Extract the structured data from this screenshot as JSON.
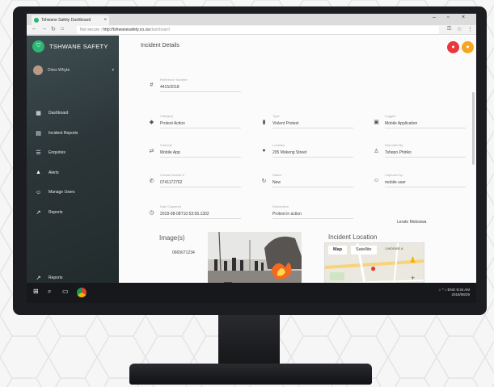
{
  "browser": {
    "tab_title": "Tshwane Safety Dashboard",
    "url_secure": "Not secure",
    "url_host": "http://tshwanesafety.co.za",
    "url_path": "/dashboard"
  },
  "sidebar": {
    "brand": "TSHWANE SAFETY",
    "user_name": "Dries Whyte",
    "items": [
      {
        "label": "Dashboard",
        "icon": "dashboard-icon"
      },
      {
        "label": "Incident Reports",
        "icon": "reports-icon"
      },
      {
        "label": "Enquiries",
        "icon": "enquiries-icon"
      },
      {
        "label": "Alerts",
        "icon": "bell-icon"
      },
      {
        "label": "Manage Users",
        "icon": "users-icon"
      },
      {
        "label": "Reports",
        "icon": "trend-icon"
      }
    ],
    "bottom_item": "Reports"
  },
  "incident": {
    "title": "Incident Details",
    "reference": {
      "label": "Reference Number",
      "value": "4415/2018"
    },
    "category": {
      "label": "Category",
      "value": "Protest Action"
    },
    "type": {
      "label": "Type",
      "value": "Violent Protest"
    },
    "logged": {
      "label": "Logged",
      "value": "Mobile Application"
    },
    "channel": {
      "label": "Channel",
      "value": "Mobile App"
    },
    "location": {
      "label": "Location",
      "value": "205 Mokeng Street"
    },
    "reported_by": {
      "label": "Reported By",
      "value": "Tshepo Phiriko"
    },
    "contact": {
      "label": "Contact Mobile #",
      "value": "0741172762"
    },
    "status": {
      "label": "Status",
      "value": "New"
    },
    "captured_by": {
      "label": "Captured by",
      "value": "mobile user"
    },
    "date_captured": {
      "label": "Date Captured",
      "value": "2018-08-08T10:53:56.1302"
    },
    "description": {
      "label": "Description",
      "value": "Protest in action"
    },
    "assignee": "Lerato Molosiwa",
    "images_title": "Image(s)",
    "image_caption": "0665671234",
    "location_title": "Incident Location",
    "map_tab_map": "Map",
    "map_tab_satellite": "Satellite",
    "map_label": "1 MODISE A"
  },
  "taskbar": {
    "lang": "ENG",
    "time": "8:34 AM",
    "date": "2018/08/29"
  },
  "colors": {
    "brand_green": "#2bb673",
    "fab_red": "#e8383c",
    "fab_orange": "#f5a623",
    "map_pin": "#e53935"
  }
}
